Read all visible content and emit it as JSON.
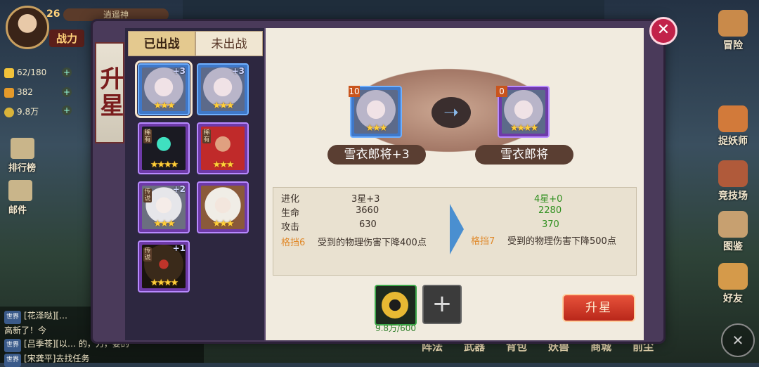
{
  "player": {
    "level": "26",
    "name": "逍遥神",
    "power_label": "战力"
  },
  "resources": [
    {
      "name": "stamina",
      "value": "62/180"
    },
    {
      "name": "gold",
      "value": "382"
    },
    {
      "name": "coins",
      "value": "9.8万"
    }
  ],
  "left_menu": {
    "rank": "排行榜",
    "mail": "邮件"
  },
  "chat": [
    {
      "tag": "世界",
      "text": "[花泽哒][…"
    },
    {
      "tag": "",
      "text": "高新了！今"
    },
    {
      "tag": "世界",
      "text": "[吕季苍][以…  的，力，要的"
    },
    {
      "tag": "世界",
      "text": "[宋龚平]去找任务"
    }
  ],
  "right_menu": [
    "冒险",
    "捉妖师",
    "竞技场",
    "图鉴",
    "好友"
  ],
  "bottom_menu": [
    "阵法",
    "武器",
    "背包",
    "妖兽",
    "商城",
    "前尘"
  ],
  "panel": {
    "title": "升星",
    "tabs": [
      "已出战",
      "未出战"
    ],
    "cards": [
      {
        "id": "c1",
        "plus": "+3",
        "stars": "★★★",
        "color": "blue",
        "selected": true
      },
      {
        "id": "c2",
        "plus": "+3",
        "stars": "★★★",
        "color": "blue"
      },
      {
        "id": "c3",
        "plus": "",
        "stars": "★★★★",
        "color": "purple",
        "tag": "稀有"
      },
      {
        "id": "c4",
        "plus": "",
        "stars": "★★★",
        "color": "purple",
        "tag": "稀有"
      },
      {
        "id": "c5",
        "plus": "+2",
        "stars": "★★★",
        "color": "purple",
        "tag": "传说"
      },
      {
        "id": "c6",
        "plus": "",
        "stars": "★★★",
        "color": "purple"
      },
      {
        "id": "c7",
        "plus": "+1",
        "stars": "★★★★",
        "color": "purple",
        "tag": "传说"
      }
    ],
    "before": {
      "badge": "10",
      "name": "雪衣郎将+3",
      "stars": "★★★"
    },
    "after": {
      "badge": "0",
      "name": "雪衣郎将",
      "stars": "★★★★"
    },
    "stats": {
      "evolve_label": "进化",
      "evolve_before": "3星+3",
      "evolve_after": "4星+0",
      "hp_label": "生命",
      "hp_before": "3660",
      "hp_after": "2280",
      "atk_label": "攻击",
      "atk_before": "630",
      "atk_after": "370",
      "block_before_label": "格挡6",
      "block_before_text": "受到的物理伤害下降400点",
      "block_after_label": "格挡7",
      "block_after_text": "受到的物理伤害下降500点"
    },
    "cost": "9.8万/600",
    "upgrade_button": "升星",
    "add_icon": "+",
    "close_icon": "✕"
  },
  "colors": {
    "accent_red": "#c2224a",
    "stat_green": "#2f8f1e",
    "stat_orange": "#e0892a"
  }
}
